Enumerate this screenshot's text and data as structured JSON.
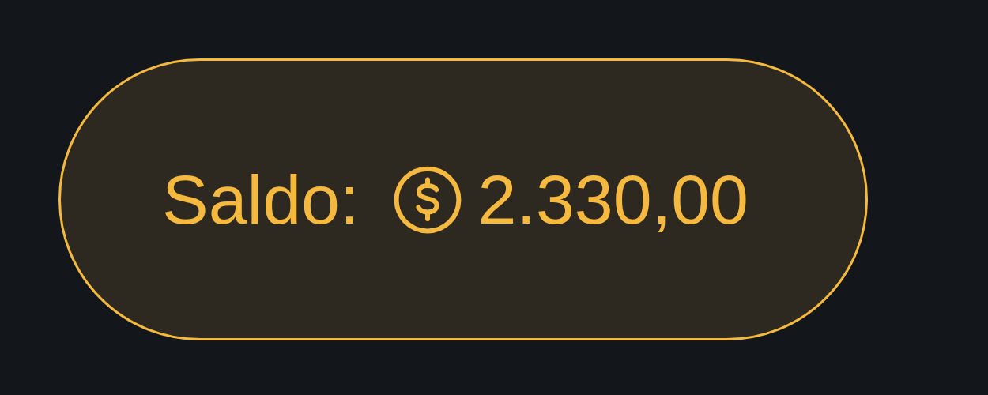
{
  "balance": {
    "label": "Saldo:",
    "amount": "2.330,00"
  }
}
